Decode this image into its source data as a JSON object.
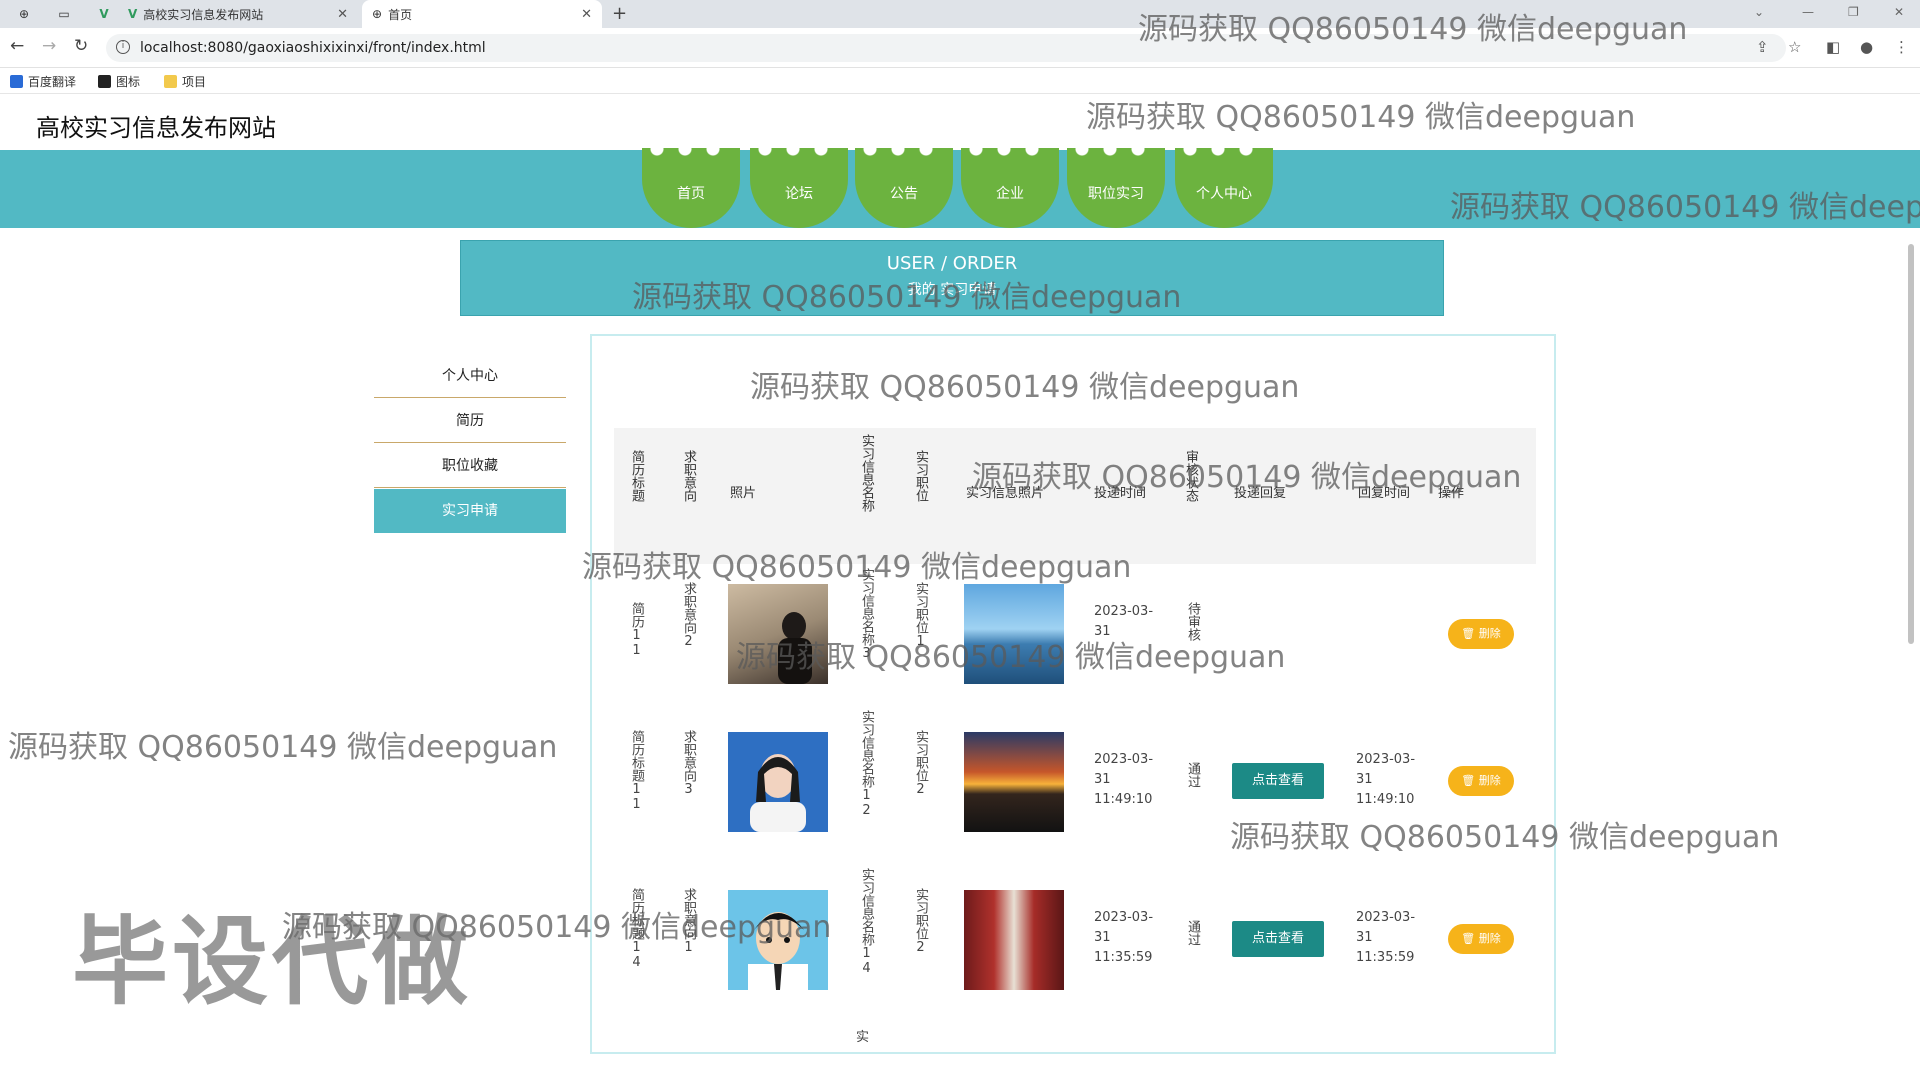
{
  "browser": {
    "tabs": [
      {
        "label": "高校实习信息发布网站"
      },
      {
        "label": "首页"
      }
    ],
    "url": "localhost:8080/gaoxiaoshixixinxi/front/index.html",
    "bookmarks": [
      {
        "label": "百度翻译"
      },
      {
        "label": "图标"
      },
      {
        "label": "项目"
      }
    ]
  },
  "site": {
    "title": "高校实习信息发布网站",
    "nav": [
      "首页",
      "论坛",
      "公告",
      "企业",
      "职位实习",
      "个人中心"
    ]
  },
  "banner": {
    "title": "USER / ORDER",
    "subtitle": "我的 实习申请"
  },
  "sidebar": {
    "items": [
      "个人中心",
      "简历",
      "职位收藏",
      "实习申请"
    ],
    "active": "实习申请"
  },
  "table": {
    "headers": [
      "简历标题",
      "求职意向",
      "照片",
      "实习信息名称",
      "实习职位",
      "实习信息照片",
      "投递时间",
      "审核状态",
      "投递回复",
      "回复时间",
      "操作"
    ],
    "rows": [
      {
        "title": "简历11",
        "intent": "求职意向2",
        "name": "实习信息名称3",
        "position": "实习职位1",
        "time": "2023-03-31",
        "status": "待审核",
        "reply": "",
        "reply_time": "",
        "delete": "删除"
      },
      {
        "title": "简历标题11",
        "intent": "求职意向3",
        "name": "实习信息名称12",
        "position": "实习职位2",
        "time": "2023-03-31 11:49:10",
        "status": "通过",
        "reply": "点击查看",
        "reply_time": "2023-03-31 11:49:10",
        "delete": "删除"
      },
      {
        "title": "简历标题14",
        "intent": "求职意向1",
        "name": "实习信息名称14",
        "position": "实习职位2",
        "time": "2023-03-31 11:35:59",
        "status": "通过",
        "reply": "点击查看",
        "reply_time": "2023-03-31 11:35:59",
        "delete": "删除"
      }
    ],
    "next_row_fragment": "实"
  },
  "watermarks": {
    "text": "源码获取 QQ86050149 微信deepguan",
    "clipped": "源码获取 QQ86050149 微信deepg",
    "big": "毕设代做"
  },
  "colors": {
    "nav_band": "#52b9c4",
    "nav_item": "#6cb33f",
    "reply_button": "#1c8a86",
    "delete_button": "#f6b31a"
  }
}
